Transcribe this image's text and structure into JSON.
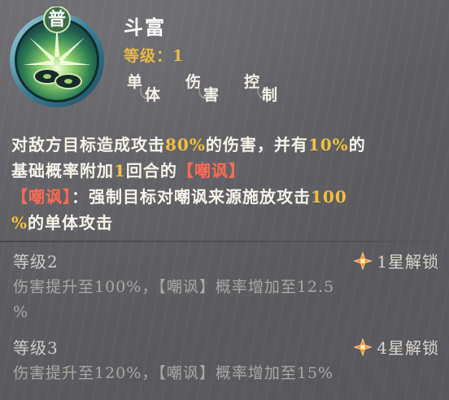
{
  "skill": {
    "icon_badge": "普",
    "icon_name": "coin-burst-icon",
    "name": "斗富",
    "level_label": "等级：1",
    "tags": [
      {
        "first": "单",
        "second": "体"
      },
      {
        "first": "伤",
        "second": "害"
      },
      {
        "first": "控",
        "second": "制"
      }
    ]
  },
  "description": {
    "line1_a": "对敌方目标造成攻击",
    "line1_pct": "80%",
    "line1_b": "的伤害，并有",
    "line1_chance": "10%",
    "line1_c": "的",
    "line2_a": "基础概率附加",
    "line2_rounds": "1",
    "line2_b": "回合的",
    "line2_status": "【嘲讽】",
    "line3_status": "【嘲讽】",
    "line3_a": "：强制目标对嘲讽来源施放攻击",
    "line3_pct": "100",
    "line4_pct": "%",
    "line4_a": "的单体攻击"
  },
  "upgrades": [
    {
      "title": "等级2",
      "unlock": "1星解锁",
      "desc_line1": "伤害提升至100%，【嘲讽】概率增加至12.5",
      "desc_line2": "%"
    },
    {
      "title": "等级3",
      "unlock": "4星解锁",
      "desc_line1": "伤害提升至120%，【嘲讽】概率增加至15%",
      "desc_line2": ""
    }
  ],
  "colors": {
    "highlight_yellow": "#f2c03f",
    "highlight_red": "#ff6a54",
    "level_gold": "#e7b84a",
    "star_orange": "#f08a3a"
  }
}
